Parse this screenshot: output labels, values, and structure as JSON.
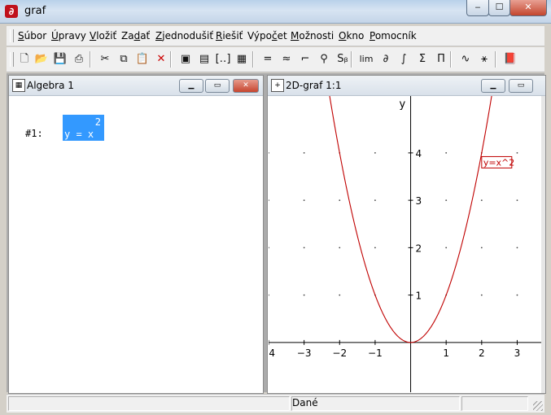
{
  "app": {
    "title": "graf",
    "window_controls": {
      "minimize": "‒",
      "maximize": "☐",
      "close": "✕"
    }
  },
  "menu": [
    {
      "underline": "S",
      "rest": "úbor"
    },
    {
      "underline": "Ú",
      "rest": "pravy"
    },
    {
      "underline": "V",
      "rest": "ložiť"
    },
    {
      "prefix": "Za",
      "underline": "d",
      "rest": "ať"
    },
    {
      "underline": "Z",
      "rest": "jednodušiť"
    },
    {
      "underline": "R",
      "rest": "iešiť"
    },
    {
      "prefix": "Výpo",
      "underline": "č",
      "rest": "et"
    },
    {
      "underline": "M",
      "rest": "ožnosti"
    },
    {
      "underline": "O",
      "rest": "kno"
    },
    {
      "underline": "P",
      "rest": "omocník"
    }
  ],
  "toolbar": {
    "icons": [
      "new-file-icon",
      "open-folder-icon",
      "save-icon",
      "print-icon",
      "cut-icon",
      "copy-icon",
      "paste-icon",
      "delete-icon",
      "author-expression-icon",
      "author-text-icon",
      "author-vector-icon",
      "author-matrix-icon",
      "equals-icon",
      "approx-icon",
      "substitute-icon",
      "find-icon",
      "subscript-icon",
      "limit-icon",
      "derivative-icon",
      "integral-icon",
      "sum-icon",
      "product-icon",
      "plot-icon",
      "solve-icon",
      "book-icon"
    ],
    "glyphs": {
      "new-file-icon": "🗋",
      "open-folder-icon": "📂",
      "save-icon": "💾",
      "print-icon": "⎙",
      "cut-icon": "✂",
      "copy-icon": "⧉",
      "paste-icon": "📋",
      "delete-icon": "✕",
      "author-expression-icon": "▣",
      "author-text-icon": "▤",
      "author-vector-icon": "[‥]",
      "author-matrix-icon": "▦",
      "equals-icon": "=",
      "approx-icon": "≈",
      "substitute-icon": "⌐",
      "find-icon": "⚲",
      "subscript-icon": "Sᵦ",
      "limit-icon": "lim",
      "derivative-icon": "∂",
      "integral-icon": "∫",
      "sum-icon": "Σ",
      "product-icon": "Π",
      "plot-icon": "∿",
      "solve-icon": "⚹",
      "book-icon": "📕"
    }
  },
  "algebra_window": {
    "title": "Algebra 1",
    "expression": {
      "label": "#1:",
      "exponent": "2",
      "text": "y = x"
    }
  },
  "graph_window": {
    "title": "2D-graf 1:1",
    "curve_label": "y=x^2",
    "curve_color": "#c00000",
    "axis_y_label": "y"
  },
  "chart_data": {
    "type": "line",
    "title": "",
    "xlabel": "",
    "ylabel": "y",
    "xlim": [
      -4,
      3.7
    ],
    "ylim": [
      -1.05,
      5.2
    ],
    "x_ticks": [
      -4,
      -3,
      -2,
      -1,
      1,
      2,
      3
    ],
    "x_tick_labels": [
      "-4",
      "−3",
      "−2",
      "−1",
      "1",
      "2",
      "3"
    ],
    "y_ticks": [
      1,
      2,
      3,
      4
    ],
    "y_tick_labels": [
      "1",
      "2",
      "3",
      "4"
    ],
    "grid": "dots",
    "series": [
      {
        "name": "y=x^2",
        "expression": "x^2",
        "color": "#c00000"
      }
    ]
  },
  "status": {
    "text": "Dané"
  }
}
